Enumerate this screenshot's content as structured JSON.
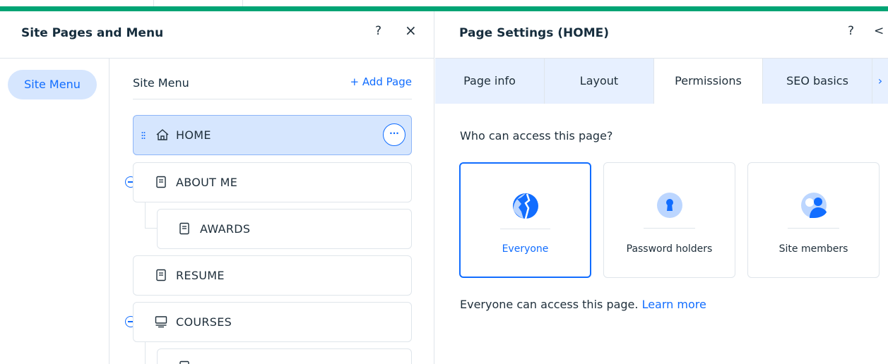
{
  "left_panel": {
    "title": "Site Pages and Menu",
    "help_icon": "?",
    "close_icon": "×",
    "side_nav": {
      "active_item": "Site Menu"
    },
    "tree": {
      "title": "Site Menu",
      "add_page_label": "+ Add Page",
      "pages": [
        {
          "label": "HOME",
          "icon": "home-icon",
          "selected": true
        },
        {
          "label": "ABOUT ME",
          "icon": "page-icon",
          "collapsible": true
        },
        {
          "label": "AWARDS",
          "icon": "page-icon",
          "child": true
        },
        {
          "label": "RESUME",
          "icon": "page-icon"
        },
        {
          "label": "COURSES",
          "icon": "monitor-icon",
          "collapsible": true
        },
        {
          "label": "",
          "icon": "page-icon",
          "child": true,
          "partial": true
        }
      ]
    }
  },
  "right_panel": {
    "title": "Page Settings (HOME)",
    "help_icon": "?",
    "back_icon": "<",
    "tabs": [
      {
        "label": "Page info"
      },
      {
        "label": "Layout"
      },
      {
        "label": "Permissions",
        "active": true
      },
      {
        "label": "SEO basics"
      }
    ],
    "tabs_more_icon": "›",
    "permissions": {
      "question": "Who can access this page?",
      "options": [
        {
          "label": "Everyone",
          "icon": "globe-icon",
          "selected": true
        },
        {
          "label": "Password holders",
          "icon": "keyhole-icon"
        },
        {
          "label": "Site members",
          "icon": "members-icon"
        }
      ],
      "info_text": "Everyone can access this page.",
      "learn_more": "Learn more"
    }
  },
  "colors": {
    "accent": "#116dff",
    "selected_bg": "#d6e6fe",
    "tabs_bg": "#e7f0ff",
    "top_stripe": "#00a474"
  }
}
